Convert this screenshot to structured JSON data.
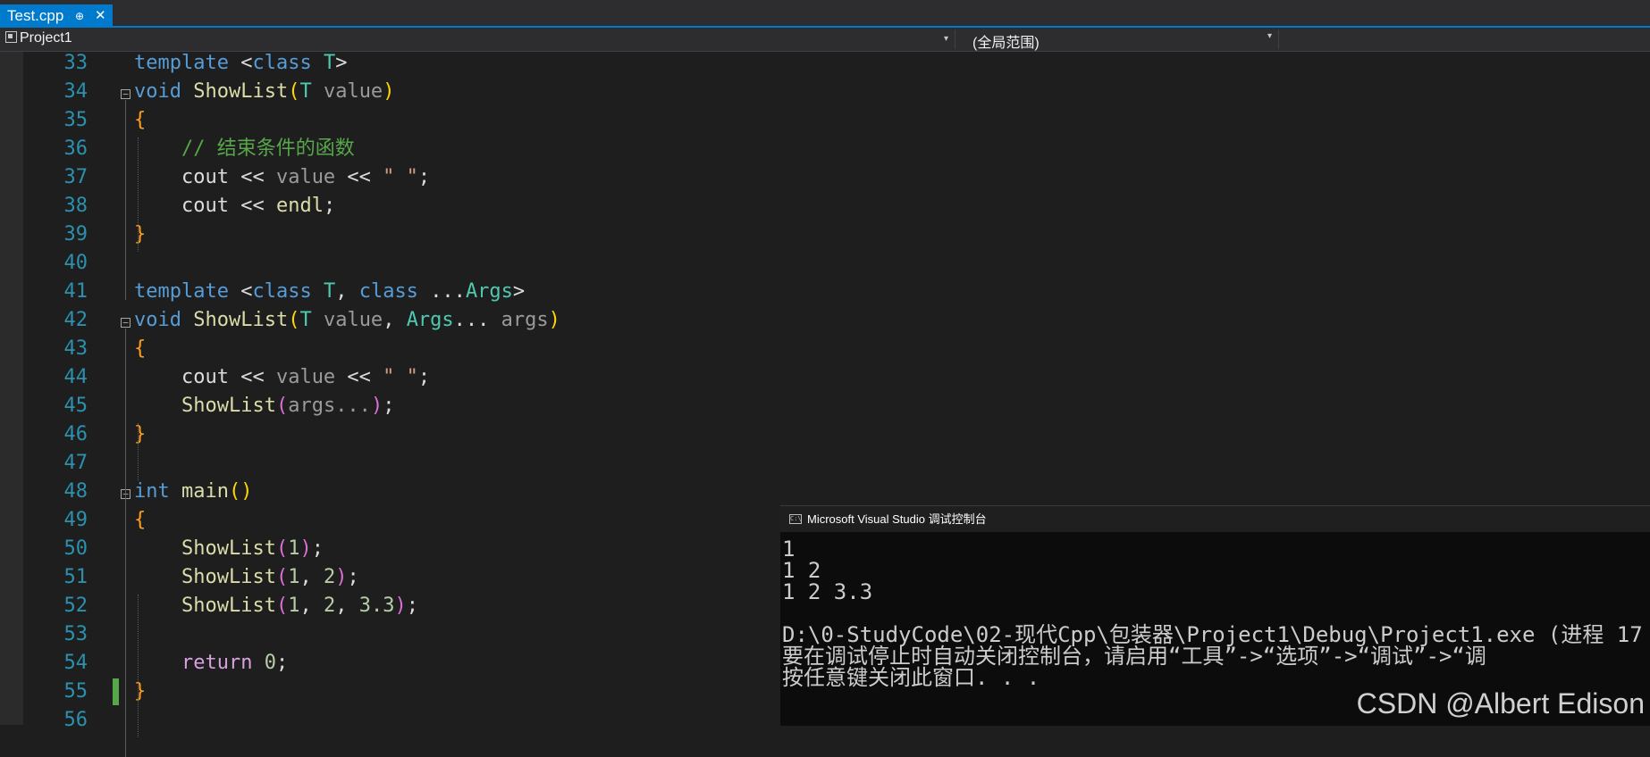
{
  "tab": {
    "title": "Test.cpp",
    "pin_glyph": "⊕",
    "close_glyph": "✕"
  },
  "navbar": {
    "project": "Project1",
    "scope": "(全局范围)"
  },
  "editor": {
    "lines": [
      {
        "num": "33",
        "tokens": [
          [
            "kw",
            "template"
          ],
          [
            "",
            "<"
          ],
          [
            "kw",
            "class"
          ],
          [
            "",
            ""
          ],
          [
            "ty",
            "T"
          ],
          [
            "",
            ">"
          ]
        ]
      },
      {
        "num": "34"
      },
      {
        "num": "35"
      },
      {
        "num": "36"
      },
      {
        "num": "37"
      },
      {
        "num": "38"
      },
      {
        "num": "39"
      },
      {
        "num": "40"
      },
      {
        "num": "41"
      },
      {
        "num": "42"
      },
      {
        "num": "43"
      },
      {
        "num": "44"
      },
      {
        "num": "45"
      },
      {
        "num": "46"
      },
      {
        "num": "47"
      },
      {
        "num": "48"
      },
      {
        "num": "49"
      },
      {
        "num": "50"
      },
      {
        "num": "51"
      },
      {
        "num": "52"
      },
      {
        "num": "53"
      },
      {
        "num": "54"
      },
      {
        "num": "55"
      },
      {
        "num": "56"
      }
    ],
    "code": {
      "l33": [
        [
          "kw",
          "template "
        ],
        [
          "",
          "<"
        ],
        [
          "kw",
          "class "
        ],
        [
          "ty",
          "T"
        ],
        [
          "",
          ">"
        ]
      ],
      "l34": [
        [
          "kw",
          "void "
        ],
        [
          "fn",
          "ShowList"
        ],
        [
          "p1",
          "("
        ],
        [
          "ty",
          "T "
        ],
        [
          "pm",
          "value"
        ],
        [
          "p1",
          ")"
        ]
      ],
      "l35": [
        [
          "br",
          "{"
        ]
      ],
      "l36": [
        [
          "cm",
          "    // 结束条件的函数"
        ]
      ],
      "l37": [
        [
          "",
          "    cout << "
        ],
        [
          "pm",
          "value"
        ],
        [
          "",
          " << "
        ],
        [
          "str",
          "\" \""
        ],
        [
          "",
          ";"
        ]
      ],
      "l38": [
        [
          "",
          "    cout << "
        ],
        [
          "fn",
          "endl"
        ],
        [
          "",
          ";"
        ]
      ],
      "l39": [
        [
          "br",
          "}"
        ]
      ],
      "l40": [],
      "l41": [
        [
          "kw",
          "template "
        ],
        [
          "",
          "<"
        ],
        [
          "kw",
          "class "
        ],
        [
          "ty",
          "T"
        ],
        [
          "",
          ", "
        ],
        [
          "kw",
          "class "
        ],
        [
          "",
          "..."
        ],
        [
          "ty",
          "Args"
        ],
        [
          "",
          ">"
        ]
      ],
      "l42": [
        [
          "kw",
          "void "
        ],
        [
          "fn",
          "ShowList"
        ],
        [
          "p1",
          "("
        ],
        [
          "ty",
          "T "
        ],
        [
          "pm",
          "value"
        ],
        [
          "",
          ", "
        ],
        [
          "ty",
          "Args"
        ],
        [
          "",
          "... "
        ],
        [
          "pm",
          "args"
        ],
        [
          "p1",
          ")"
        ]
      ],
      "l43": [
        [
          "br",
          "{"
        ]
      ],
      "l44": [
        [
          "",
          "    cout << "
        ],
        [
          "pm",
          "value"
        ],
        [
          "",
          " << "
        ],
        [
          "str",
          "\" \""
        ],
        [
          "",
          ";"
        ]
      ],
      "l45": [
        [
          "",
          "    "
        ],
        [
          "fn",
          "ShowList"
        ],
        [
          "p2",
          "("
        ],
        [
          "pm",
          "args"
        ],
        [
          "pm",
          "..."
        ],
        [
          "p2",
          ")"
        ],
        [
          "",
          ";"
        ]
      ],
      "l46": [
        [
          "br",
          "}"
        ]
      ],
      "l47": [],
      "l48": [
        [
          "kw",
          "int "
        ],
        [
          "fn",
          "main"
        ],
        [
          "p1",
          "()"
        ]
      ],
      "l49": [
        [
          "br",
          "{"
        ]
      ],
      "l50": [
        [
          "",
          "    "
        ],
        [
          "fn",
          "ShowList"
        ],
        [
          "p2",
          "("
        ],
        [
          "num",
          "1"
        ],
        [
          "p2",
          ")"
        ],
        [
          "",
          ";"
        ]
      ],
      "l51": [
        [
          "",
          "    "
        ],
        [
          "fn",
          "ShowList"
        ],
        [
          "p2",
          "("
        ],
        [
          "num",
          "1"
        ],
        [
          "",
          ", "
        ],
        [
          "num",
          "2"
        ],
        [
          "p2",
          ")"
        ],
        [
          "",
          ";"
        ]
      ],
      "l52": [
        [
          "",
          "    "
        ],
        [
          "fn",
          "ShowList"
        ],
        [
          "p2",
          "("
        ],
        [
          "num",
          "1"
        ],
        [
          "",
          ", "
        ],
        [
          "num",
          "2"
        ],
        [
          "",
          ", "
        ],
        [
          "num",
          "3.3"
        ],
        [
          "p2",
          ")"
        ],
        [
          "",
          ";"
        ]
      ],
      "l53": [],
      "l54": [
        [
          "",
          "    "
        ],
        [
          "ctl",
          "return "
        ],
        [
          "num",
          "0"
        ],
        [
          "",
          ";"
        ]
      ],
      "l55": [
        [
          "br",
          "}"
        ]
      ],
      "l56": []
    }
  },
  "console": {
    "title": "Microsoft Visual Studio 调试控制台",
    "icon_glyph": "C:\\",
    "lines": [
      "1",
      "1 2",
      "1 2 3.3",
      "",
      "D:\\0-StudyCode\\02-现代Cpp\\包装器\\Project1\\Debug\\Project1.exe (进程 17",
      "要在调试停止时自动关闭控制台，请启用“工具”->“选项”->“调试”->“调",
      "按任意键关闭此窗口. . ."
    ]
  },
  "watermark": "CSDN @Albert Edison"
}
